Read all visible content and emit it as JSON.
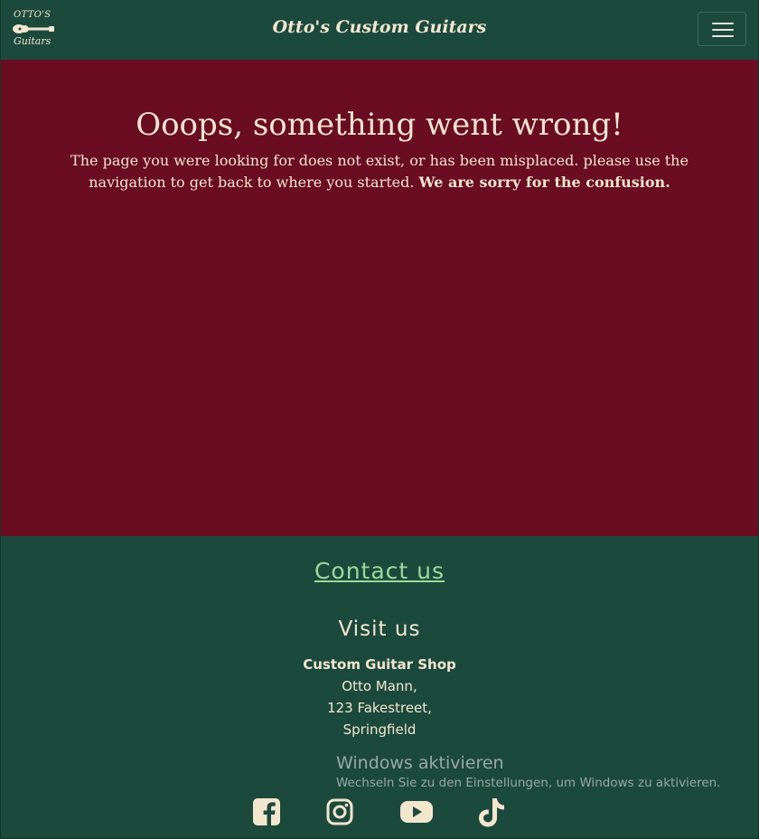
{
  "navbar": {
    "logo_top": "OTTO'S",
    "logo_bottom": "Guitars",
    "brand": "Otto's Custom Guitars"
  },
  "error": {
    "title": "Ooops, something went wrong!",
    "message": "The page you were looking for does not exist, or has been misplaced. please use the navigation to get back to where you started. ",
    "apology": "We are sorry for the confusion."
  },
  "footer": {
    "contact_link": "Contact us",
    "visit_title": "Visit us",
    "address": {
      "shop_name": "Custom Guitar Shop",
      "owner": "Otto Mann,",
      "street": "123 Fakestreet,",
      "city": "Springfield"
    },
    "social_icons": [
      "facebook-icon",
      "instagram-icon",
      "youtube-icon",
      "tiktok-icon"
    ]
  },
  "os_watermark": {
    "title": "Windows aktivieren",
    "subtitle": "Wechseln Sie zu den Einstellungen, um Windows zu aktivieren."
  },
  "colors": {
    "nav_footer_bg": "#1b4a3d",
    "error_bg": "#6a0c22",
    "text_cream": "#f3e6cf",
    "link_green": "#9ed99a"
  }
}
